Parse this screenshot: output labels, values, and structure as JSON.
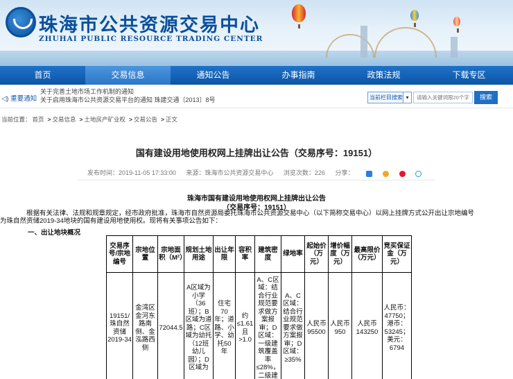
{
  "header": {
    "title_cn": "珠海市公共资源交易中心",
    "title_en": "ZHUHAI PUBLIC RESOURCE TRADING CENTER"
  },
  "nav": {
    "items": [
      {
        "label": "首页"
      },
      {
        "label": "交易信息"
      },
      {
        "label": "通知公告"
      },
      {
        "label": "办事指南"
      },
      {
        "label": "政策法规"
      },
      {
        "label": "下载专区"
      }
    ]
  },
  "notice": {
    "label": "重要通知",
    "lines": [
      "关于完善土地市场工作机制的通知",
      "关于启用珠海市公共资源交易平台的通知 珠建交通〔2013〕8号"
    ]
  },
  "search": {
    "scope_label": "当前栏目搜索",
    "placeholder": "请输入关键词限20个字",
    "button": "搜索"
  },
  "breadcrumb": {
    "prefix": "当前位置：",
    "items": [
      "首页",
      "交易信息",
      "土地房产矿业权",
      "交易公告",
      "正文"
    ]
  },
  "article": {
    "title": "国有建设用地使用权网上挂牌出让公告（交易序号：19151）",
    "publish": "发布时间：2019-11-05 17:33:00",
    "source": "来源：珠海市公共资源交易中心",
    "views": "浏览次数：226",
    "share": "分享："
  },
  "doc": {
    "title": "珠海市国有建设用地使用权网上挂牌出让公告",
    "subtitle": "（交易序号：19151）",
    "para_line1": "根据有关法律、法规和规章规定，经市政府批准，珠海市自然资源局委托珠海市公共资源交易中心（以下简称交易中心）以网上挂牌方式公开出让宗地编号",
    "para_line2": "为珠自然资储2019-34地块的国有建设用地使用权。现将有关事项公告如下：",
    "section1": "一、出让地块概况"
  },
  "table": {
    "headers": [
      "交易序号/宗地编号",
      "宗地位置",
      "宗地面积（M²）",
      "规划土地用途",
      "出让年限",
      "容积率",
      "建筑密度",
      "绿地率",
      "起始价（万元）",
      "增价幅度（万元）",
      "最高限价（万元）",
      "竞买保证金（万元）"
    ],
    "row": [
      "19151/珠自然资储2019-34",
      "金湾区金河东路南侧、金泓路西侧",
      "72044.5",
      "A区域为小学（36班）；B区域为道路；C区域为幼托（12班幼儿园）；D区域为",
      "住宅70年；道路、小学、幼托50年",
      "约≤1.61且>1.0",
      "A、C区域：结合行业规范要求做方案报审；D区域：一级建筑覆盖率≤28%，二级建",
      "A、C区域：结合行业规范要求做方案报审；D区域：≥35%",
      "人民币95500",
      "人民币950",
      "人民币143250",
      "人民币：47750；港币：53245；美元：6794"
    ]
  },
  "colors": {
    "brand_blue": "#0b4f9c",
    "nav_blue": "#1f72c8",
    "button_blue": "#1f6fc4"
  }
}
